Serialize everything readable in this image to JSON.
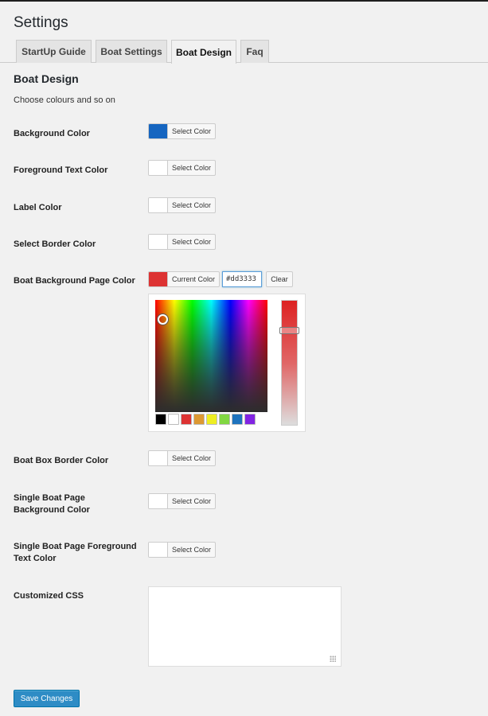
{
  "page": {
    "title": "Settings"
  },
  "tabs": [
    {
      "label": "StartUp Guide",
      "active": false
    },
    {
      "label": "Boat Settings",
      "active": false
    },
    {
      "label": "Boat Design",
      "active": true
    },
    {
      "label": "Faq",
      "active": false
    }
  ],
  "section": {
    "title": "Boat Design",
    "description": "Choose colours and so on"
  },
  "fields": {
    "background_color": {
      "label": "Background Color",
      "button": "Select Color",
      "swatch": "#1565c0"
    },
    "foreground_text_color": {
      "label": "Foreground Text Color",
      "button": "Select Color",
      "swatch": "#ffffff"
    },
    "label_color": {
      "label": "Label Color",
      "button": "Select Color",
      "swatch": "#ffffff"
    },
    "select_border_color": {
      "label": "Select Border Color",
      "button": "Select Color",
      "swatch": "#ffffff"
    },
    "boat_background_page_color": {
      "label": "Boat Background Page Color",
      "button": "Current Color",
      "swatch": "#dd3333",
      "hex_value": "#dd3333",
      "clear_label": "Clear"
    },
    "boat_box_border_color": {
      "label": "Boat Box Border Color",
      "button": "Select Color",
      "swatch": "#ffffff"
    },
    "single_boat_page_bg_color": {
      "label_line1": "Single Boat Page",
      "label_line2": "Background Color",
      "button": "Select Color",
      "swatch": "#ffffff"
    },
    "single_boat_page_fg_text_color": {
      "label_line1": "Single Boat Page Foreground",
      "label_line2": "Text Color",
      "button": "Select Color",
      "swatch": "#ffffff"
    },
    "customized_css": {
      "label": "Customized CSS",
      "value": ""
    }
  },
  "picker_palette": [
    "#000000",
    "#ffffff",
    "#dd3333",
    "#dd9933",
    "#eeee22",
    "#81d742",
    "#1e73be",
    "#8224e3"
  ],
  "actions": {
    "save_label": "Save Changes"
  }
}
